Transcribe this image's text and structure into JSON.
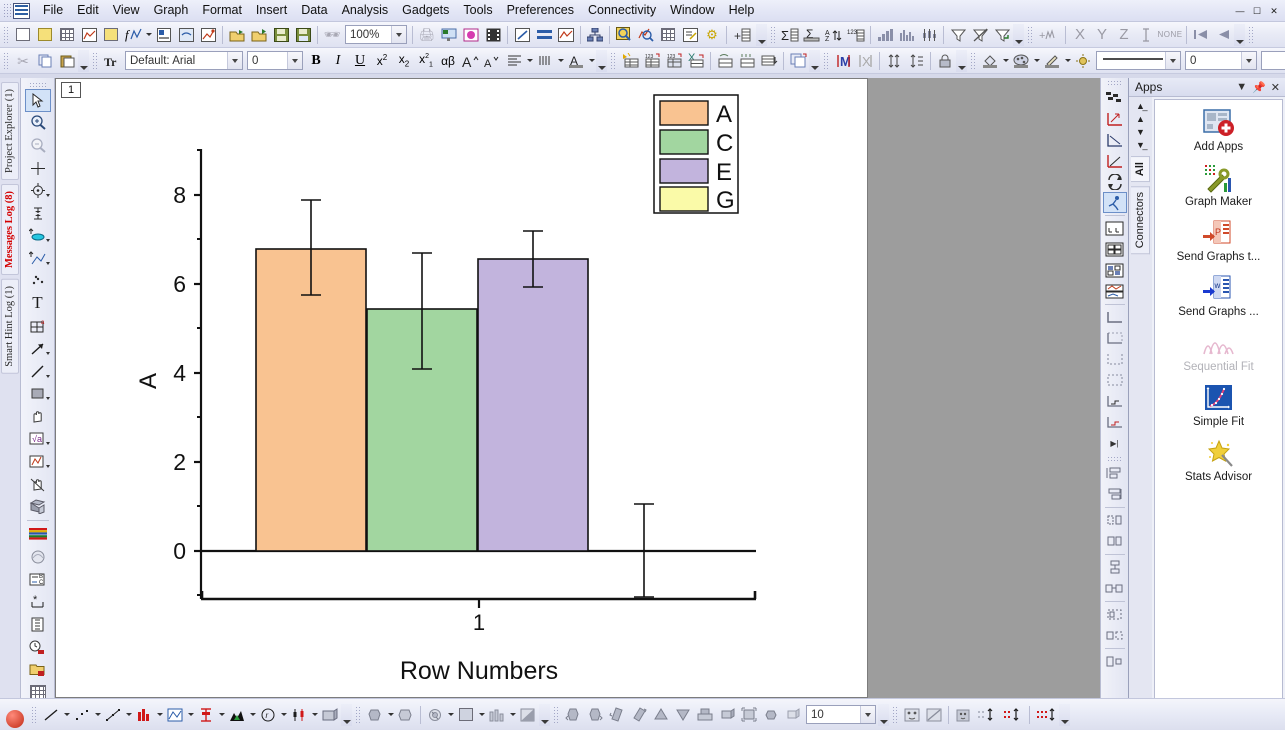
{
  "app": {
    "title": "Origin",
    "icon": "origin-app-icon"
  },
  "menubar": {
    "items": [
      {
        "label": "File"
      },
      {
        "label": "Edit"
      },
      {
        "label": "View"
      },
      {
        "label": "Graph"
      },
      {
        "label": "Format"
      },
      {
        "label": "Insert"
      },
      {
        "label": "Data"
      },
      {
        "label": "Analysis"
      },
      {
        "label": "Gadgets"
      },
      {
        "label": "Tools"
      },
      {
        "label": "Preferences"
      },
      {
        "label": "Connectivity"
      },
      {
        "label": "Window"
      },
      {
        "label": "Help"
      }
    ],
    "window_controls": [
      "minimize",
      "restore",
      "close"
    ]
  },
  "toolbar_standard": {
    "zoom_value": "100%",
    "icons": [
      "new-project-icon",
      "new-folder-icon",
      "new-workbook-icon",
      "new-graph-icon",
      "new-matrix-icon",
      "new-function-plot-icon",
      "new-layout-icon",
      "new-notes-icon",
      "new-excel-icon",
      "open-icon",
      "open-template-icon",
      "save-project-icon",
      "save-template-icon",
      "run-script-icon"
    ],
    "icons2": [
      "print-icon",
      "print-preview-icon",
      "import-wizard-icon",
      "import-video-icon",
      "edit-mode-icon",
      "merge-graph-icon",
      "extract-graph-icon",
      "layer-management-icon",
      "data-reader-icon",
      "screen-reader-icon",
      "worksheet-icon",
      "report-icon",
      "gear-icon",
      "add-column-icon"
    ],
    "icons3": [
      "statistics-icon",
      "descriptive-stats-icon",
      "sort-az-icon",
      "set-values-icon",
      "column-bar-icon",
      "histogram-icon",
      "box-chart-icon",
      "filter-icon",
      "remove-filter-icon",
      "reapply-filter-icon"
    ],
    "icons4": [
      "add-function-icon",
      "x-function-icon",
      "y-function-icon",
      "z-function-icon",
      "error-bar-icon",
      "none-icon",
      "first-layer-icon",
      "previous-layer-icon"
    ],
    "none_label": "NONE"
  },
  "toolbar_format": {
    "font_name": "Default: Arial",
    "font_size": "0",
    "line_width": "0",
    "icons": [
      "cut-icon",
      "copy-icon",
      "paste-icon",
      "font-icon",
      "bold-icon",
      "italic-icon",
      "underline-icon",
      "superscript-icon",
      "subscript-icon",
      "supsub-icon",
      "greek-icon",
      "increase-font-icon",
      "decrease-font-icon",
      "align-icon",
      "line-spacing-icon",
      "font-color-icon"
    ],
    "icons2": [
      "mask-icon",
      "rescale-icon",
      "unmask-icon",
      "lock-icon",
      "fill-color-icon",
      "pattern-icon",
      "line-color-icon",
      "lighting-icon",
      "set-as-begin-icon",
      "set-as-end-icon",
      "clear-begin-end-icon",
      "shift-data-icon",
      "normalize-icon",
      "subtract-reference-icon",
      "interpolate-icon",
      "copy-cells-icon",
      "merge-icon",
      "split-icon"
    ]
  },
  "left_panel_tabs": [
    {
      "label": "Project Explorer (1)",
      "alert": false
    },
    {
      "label": "Messages Log (8)",
      "alert": true
    },
    {
      "label": "Smart Hint Log (1)",
      "alert": false
    }
  ],
  "left_tools": [
    {
      "name": "pointer-tool",
      "selected": true
    },
    {
      "name": "zoom-in-tool",
      "selected": false
    },
    {
      "name": "zoom-out-tool",
      "selected": false
    },
    {
      "name": "screen-reader-tool",
      "selected": false
    },
    {
      "name": "data-reader-tool",
      "selected": false
    },
    {
      "name": "data-selector-tool",
      "selected": false
    },
    {
      "name": "draw-data-tool",
      "selected": false
    },
    {
      "name": "regional-mask-tool",
      "selected": false
    },
    {
      "name": "scatter-tool",
      "selected": false
    },
    {
      "name": "text-tool",
      "selected": false
    },
    {
      "name": "add-object-tool",
      "selected": false
    },
    {
      "name": "arrow-tool",
      "selected": false
    },
    {
      "name": "line-tool",
      "selected": false
    },
    {
      "name": "rectangle-tool",
      "selected": false
    },
    {
      "name": "pan-tool",
      "selected": false
    },
    {
      "name": "equation-tool",
      "selected": false
    },
    {
      "name": "region-tool",
      "selected": false
    },
    {
      "name": "rotate-tool",
      "selected": false
    },
    {
      "name": "3d-rotate-tool",
      "selected": false
    },
    {
      "name": "color-scale-tool",
      "selected": false
    },
    {
      "name": "sphere-tool",
      "selected": false
    },
    {
      "name": "text-b-c-tool",
      "selected": false
    },
    {
      "name": "asterisk-tool",
      "selected": false
    },
    {
      "name": "scale-tool",
      "selected": false
    },
    {
      "name": "clock-stamp-tool",
      "selected": false
    },
    {
      "name": "folder-stamp-tool",
      "selected": false
    },
    {
      "name": "grid-tool",
      "selected": false
    }
  ],
  "right_tools": [
    {
      "name": "pattern-icon",
      "selected": false
    },
    {
      "name": "axis-red-icon",
      "selected": false
    },
    {
      "name": "axis-down-icon",
      "selected": false
    },
    {
      "name": "axis-up-icon",
      "selected": false
    },
    {
      "name": "exchange-icon",
      "selected": false
    },
    {
      "name": "runner-icon",
      "selected": true
    },
    {
      "name": "merge-layers-icon",
      "selected": false
    },
    {
      "name": "four-panel-icon",
      "selected": false
    },
    {
      "name": "grid-panels-icon",
      "selected": false
    },
    {
      "name": "stack-lines-icon",
      "selected": false
    },
    {
      "name": "bottom-left-axis-icon",
      "selected": false
    },
    {
      "name": "full-frame-icon",
      "selected": false
    },
    {
      "name": "right-axis-icon",
      "selected": false
    },
    {
      "name": "box-axis-icon",
      "selected": false
    },
    {
      "name": "step-axis-icon",
      "selected": false
    },
    {
      "name": "colored-axis-icon",
      "selected": false
    },
    {
      "name": "align-top-icon",
      "selected": false
    },
    {
      "name": "align-middle-icon",
      "selected": false
    },
    {
      "name": "align-left-icon",
      "selected": false
    },
    {
      "name": "align-right-icon",
      "selected": false
    },
    {
      "name": "distribute-v-icon",
      "selected": false
    },
    {
      "name": "distribute-h-icon",
      "selected": false
    },
    {
      "name": "group-icon",
      "selected": false
    },
    {
      "name": "ungroup-icon",
      "selected": false
    },
    {
      "name": "size-match-icon",
      "selected": false
    }
  ],
  "graph_window": {
    "tab_number": "1"
  },
  "chart_data": {
    "type": "bar",
    "title": "",
    "xlabel": "Row Numbers",
    "ylabel": "A",
    "categories": [
      "1"
    ],
    "xtick_labels": [
      "1"
    ],
    "ylim": [
      -2,
      9
    ],
    "yticks": [
      0,
      2,
      4,
      6,
      8
    ],
    "ytick_labels": [
      "0",
      "2",
      "4",
      "6",
      "8"
    ],
    "minor_ticks": true,
    "grid": false,
    "legend": {
      "position": "top-right",
      "entries": [
        {
          "label": "A",
          "color": "#f9c391"
        },
        {
          "label": "C",
          "color": "#a2d6a0"
        },
        {
          "label": "E",
          "color": "#c2b4dd"
        },
        {
          "label": "G",
          "color": "#fafaa8"
        }
      ]
    },
    "series": [
      {
        "name": "A",
        "color": "#f9c391",
        "value": 6.78,
        "err_low": 5.78,
        "err_high": 7.85
      },
      {
        "name": "C",
        "color": "#a2d6a0",
        "value": 5.4,
        "err_low": 4.12,
        "err_high": 6.52
      },
      {
        "name": "E",
        "color": "#c2b4dd",
        "value": 6.55,
        "err_low": 5.9,
        "err_high": 7.12
      },
      {
        "name": "G",
        "color": "#fafaa8",
        "value": 0.0,
        "err_low": -1.1,
        "err_high": 1.05
      }
    ]
  },
  "apps_panel": {
    "title": "Apps",
    "header_buttons": [
      "chevron-down-icon",
      "pin-icon",
      "close-icon"
    ],
    "rail_arrows": [
      "first-icon",
      "up-icon",
      "down-icon",
      "last-icon"
    ],
    "rail_tabs": [
      {
        "label": "All",
        "active": true
      },
      {
        "label": "Connectors",
        "active": false
      }
    ],
    "items": [
      {
        "label": "Add Apps",
        "icon": "add-apps-icon",
        "dim": false
      },
      {
        "label": "Graph Maker",
        "icon": "graph-maker-icon",
        "dim": false
      },
      {
        "label": "Send Graphs t...",
        "icon": "send-graphs-powerpoint-icon",
        "dim": false
      },
      {
        "label": "Send Graphs ...",
        "icon": "send-graphs-word-icon",
        "dim": false
      },
      {
        "label": "Sequential Fit",
        "icon": "sequential-fit-icon",
        "dim": true
      },
      {
        "label": "Simple Fit",
        "icon": "simple-fit-icon",
        "dim": false
      },
      {
        "label": "Stats Advisor",
        "icon": "stats-advisor-icon",
        "dim": false
      }
    ]
  },
  "bottom_toolbar": {
    "value_box": "10",
    "icons": [
      "line-plot-icon",
      "scatter-plot-icon",
      "line-symbol-icon",
      "column-plot-icon",
      "area-plot-icon",
      "stack-column-icon",
      "fill-area-icon",
      "polar-plot-icon",
      "high-low-close-icon",
      "3d-waterfall-icon"
    ],
    "icons2": [
      "contour-icon",
      "image-plot-icon",
      "3d-bar-icon",
      "heatmap-icon"
    ],
    "icons3": [
      "rotate-left-icon",
      "rotate-right-icon",
      "tilt-left-icon",
      "tilt-right-icon",
      "perspective-up-icon",
      "perspective-down-icon",
      "resize-icon",
      "skew-icon",
      "fit-frame-icon",
      "zoom-3d-icon",
      "reset-3d-icon"
    ],
    "icons4": [
      "mask-points-icon",
      "unmask-points-icon",
      "show-masked-icon",
      "hide-points-icon",
      "swap-points-icon",
      "move-points-icon"
    ]
  }
}
